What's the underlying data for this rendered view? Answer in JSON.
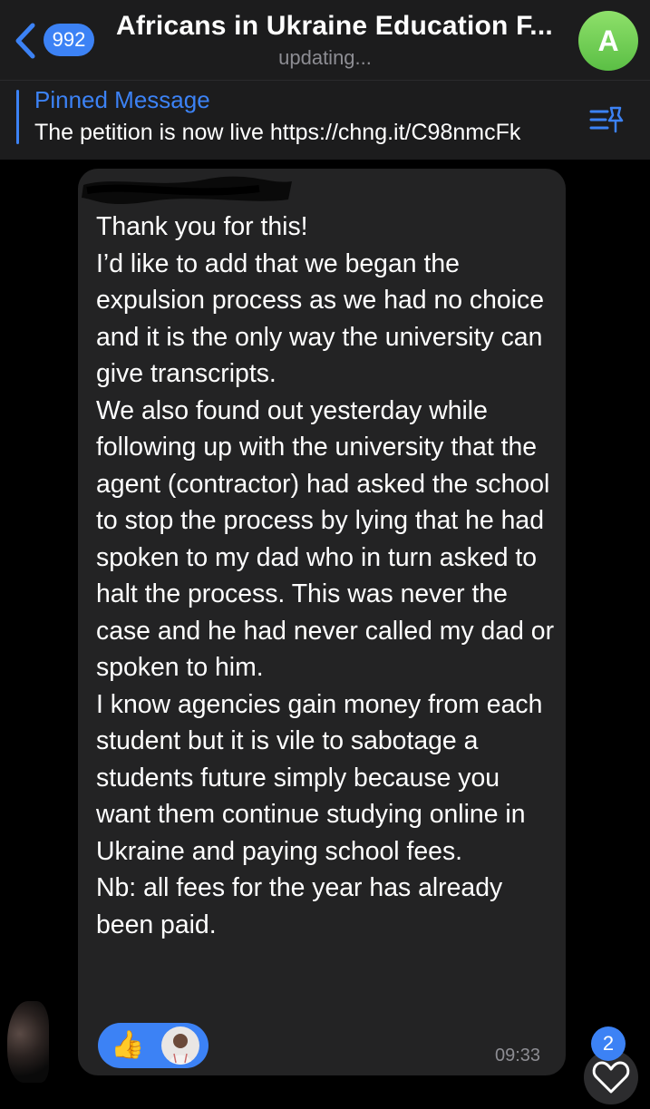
{
  "header": {
    "back_count": "992",
    "title": "Africans in Ukraine Education F...",
    "status": "updating...",
    "avatar_letter": "A"
  },
  "pinned": {
    "label": "Pinned Message",
    "text": "The petition is now live https://chng.it/C98nmcFk"
  },
  "message": {
    "text": "Thank you for this!\nI’d like to add that we began the expulsion process as we had no choice and it is the only way the university can give transcripts.\nWe also found out yesterday while following up with the university that the agent (contractor) had asked the school to stop the process by lying that he had spoken to my dad who in turn asked to halt the process. This was never the case and he had never called my dad or spoken to him.\nI know agencies gain money from each student but it is vile to sabotage a students future simply because you want them continue studying online in Ukraine and paying school fees.\nNb: all fees for the year has already been paid.",
    "time": "09:33",
    "reaction_emoji": "👍"
  },
  "unread_count": "2",
  "icons": [
    "chevron-left-icon",
    "unpin-icon",
    "thumbs-up-icon",
    "heart-icon"
  ],
  "colors": {
    "accent": "#3c82f5",
    "bubble": "#232324",
    "avatar": "#6fcf55"
  }
}
